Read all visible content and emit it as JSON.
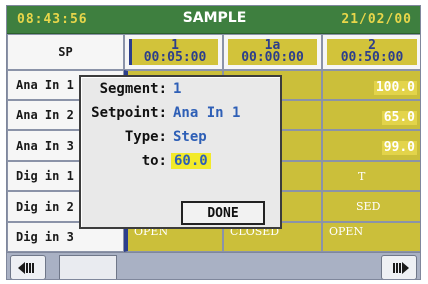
{
  "header": {
    "time": "08:43:56",
    "title": "SAMPLE",
    "date": "21/02/00"
  },
  "grid": {
    "corner_label": "SP",
    "columns": [
      {
        "segment": "1",
        "duration": "00:05:00"
      },
      {
        "segment": "1a",
        "duration": "00:00:00"
      },
      {
        "segment": "2",
        "duration": "00:50:00"
      }
    ],
    "rows": [
      {
        "label": "Ana In 1",
        "cells": [
          "",
          "",
          "100.0"
        ]
      },
      {
        "label": "Ana In 2",
        "cells": [
          "",
          "",
          "65.0"
        ]
      },
      {
        "label": "Ana In 3",
        "cells": [
          "",
          "",
          "99.0"
        ]
      },
      {
        "label": "Dig in 1",
        "cells": [
          "",
          "",
          "T"
        ]
      },
      {
        "label": "Dig in 2",
        "cells": [
          "",
          "",
          "SED"
        ]
      },
      {
        "label": "Dig in 3",
        "cells": [
          "OPEN",
          "CLOSED",
          "OPEN"
        ]
      }
    ]
  },
  "dialog": {
    "segment_label": "Segment:",
    "segment_value": "1",
    "setpoint_label": "Setpoint:",
    "setpoint_value": "Ana In 1",
    "type_label": "Type:",
    "type_value": "Step",
    "to_label": "to:",
    "to_value": "60.0",
    "done_label": "DONE"
  },
  "footer": {
    "left_icon": "scroll-left-icon",
    "right_icon": "scroll-right-icon"
  }
}
